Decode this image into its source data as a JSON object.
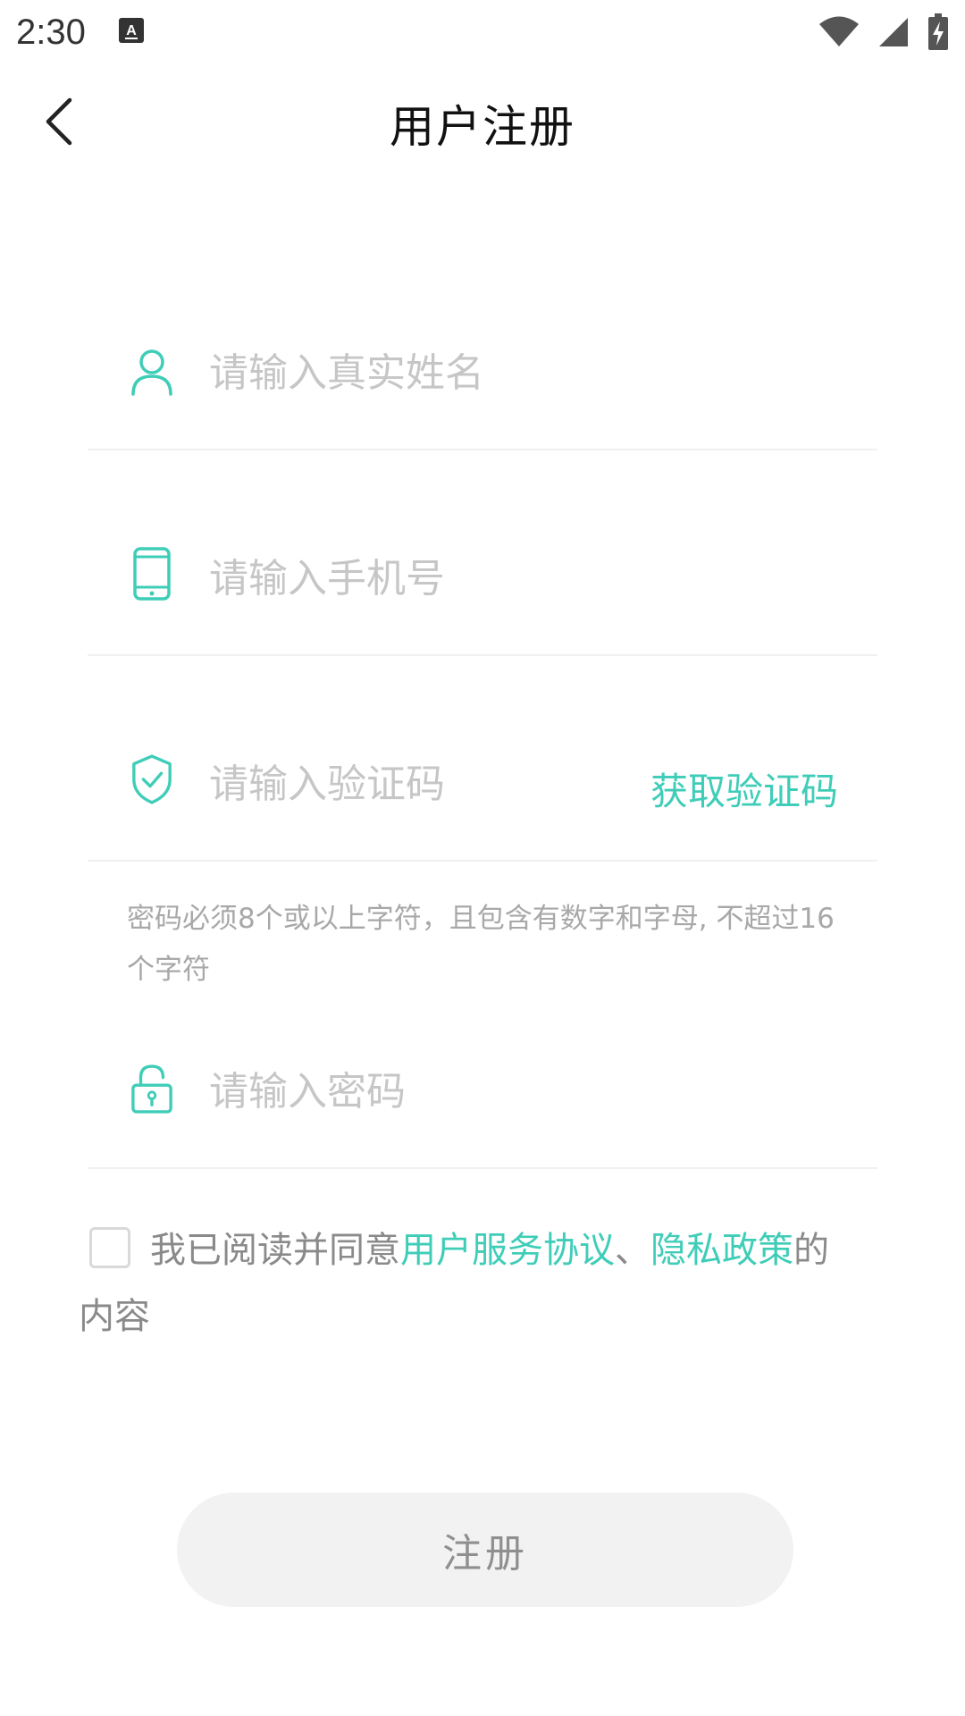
{
  "status_bar": {
    "time": "2:30",
    "icons": [
      "keyboard-icon",
      "wifi-icon",
      "signal-icon",
      "battery-charging-icon"
    ]
  },
  "header": {
    "back_icon": "chevron-left-icon",
    "title": "用户注册"
  },
  "form": {
    "name": {
      "placeholder": "请输入真实姓名",
      "value": "",
      "icon": "user-icon"
    },
    "phone": {
      "placeholder": "请输入手机号",
      "value": "",
      "icon": "phone-icon"
    },
    "code": {
      "placeholder": "请输入验证码",
      "value": "",
      "icon": "shield-check-icon",
      "get_code_label": "获取验证码"
    },
    "password_hint": "密码必须8个或以上字符，且包含有数字和字母, 不超过16个字符",
    "password": {
      "placeholder": "请输入密码",
      "value": "",
      "icon": "lock-icon"
    }
  },
  "agreement": {
    "checked": false,
    "prefix": "我已阅读并同意",
    "terms_label": "用户服务协议",
    "separator": "、",
    "privacy_label": "隐私政策",
    "suffix": "的内容"
  },
  "register_button_label": "注册",
  "colors": {
    "accent": "#3fcdb8",
    "placeholder": "#c6c6c6",
    "button_bg": "#f2f2f2",
    "button_text": "#8f8f8f"
  }
}
